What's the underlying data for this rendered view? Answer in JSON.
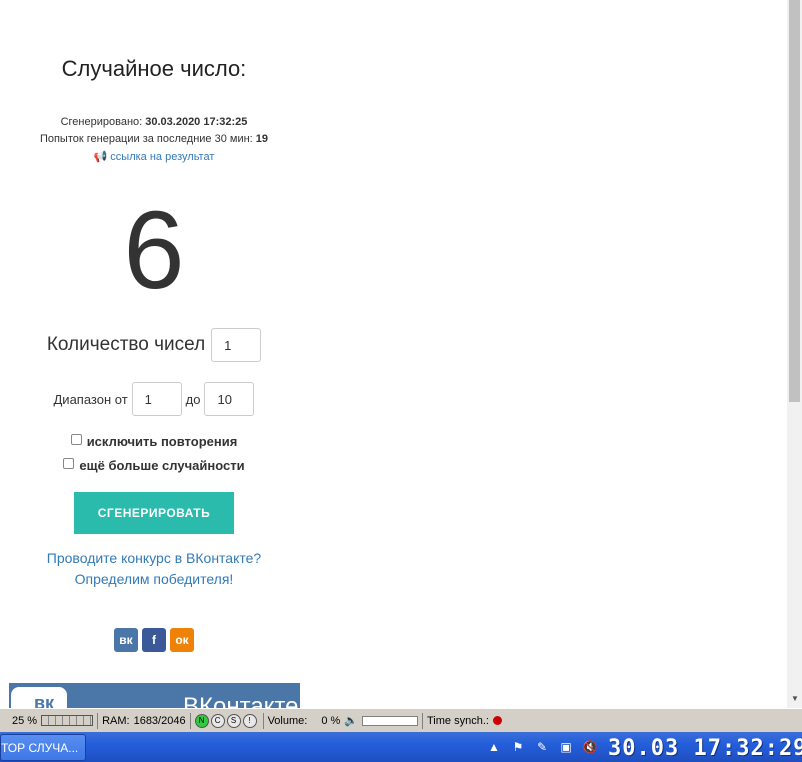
{
  "generator": {
    "title": "Случайное число:",
    "generated_label": "Сгенерировано:",
    "generated_value": "30.03.2020 17:32:25",
    "attempts_label": "Попыток генерации за последние 30 мин:",
    "attempts_value": "19",
    "result_link": "ссылка на результат",
    "result_number": "6",
    "count_label": "Количество чисел",
    "count_value": "1",
    "range_from_label": "Диапазон от",
    "range_from_value": "1",
    "range_to_label": "до",
    "range_to_value": "10",
    "exclude_repeats_label": "исключить повторения",
    "more_random_label": "ещё больше случайности",
    "generate_button": "СГЕНЕРИРОВАТЬ",
    "promo_line1": "Проводите конкурс в ВКонтакте?",
    "promo_line2": "Определим победителя!"
  },
  "social": {
    "vk": "вк",
    "fb": "f",
    "ok": "ок"
  },
  "vk_banner": {
    "logo": "вк",
    "name": "ВКонтакте"
  },
  "statusbar": {
    "cpu_value": "25 %",
    "ram_label": "RAM:",
    "ram_value": "1683/2046",
    "leds": [
      "N",
      "C",
      "S",
      "!"
    ],
    "volume_label": "Volume:",
    "volume_value": "0 %",
    "time_synch_label": "Time synch.:"
  },
  "taskbar": {
    "task_label": "ТОР СЛУЧА...",
    "clock": "30.03 17:32:29"
  },
  "colors": {
    "accent": "#2bbbad",
    "link": "#337ab7",
    "vk": "#4a76a8",
    "fb": "#3b5998",
    "ok": "#ee8208"
  }
}
